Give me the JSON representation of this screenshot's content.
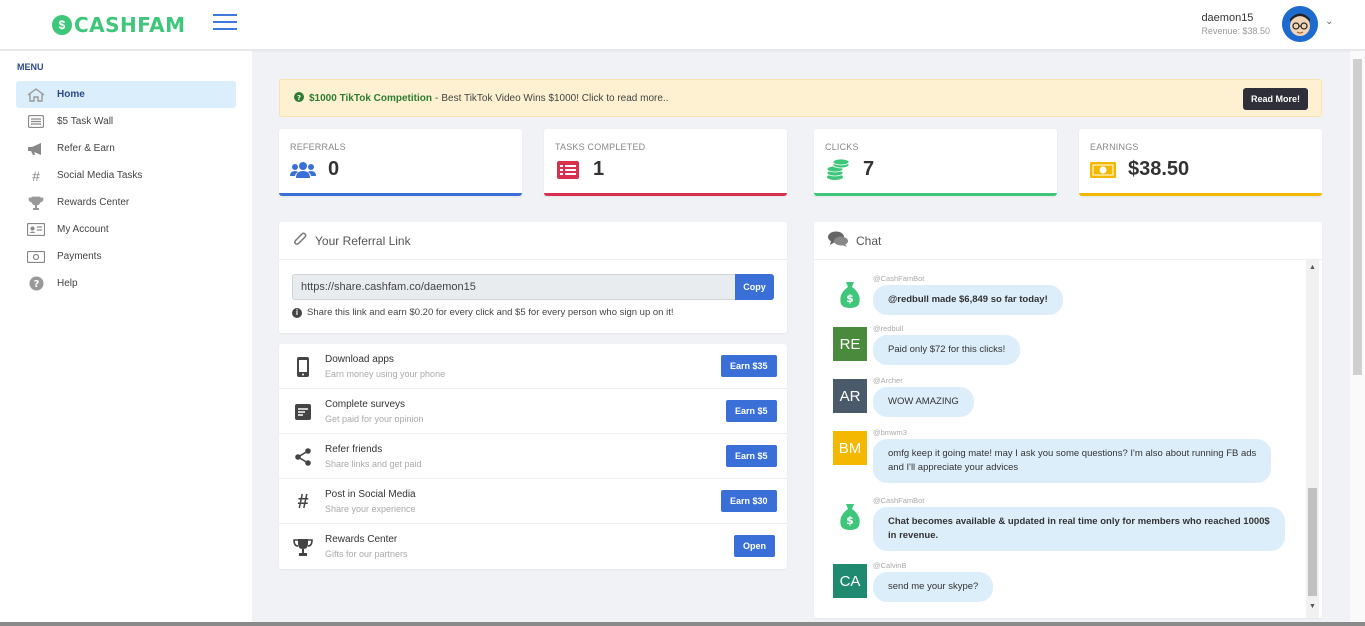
{
  "header": {
    "logo_badge": "$",
    "logo_text": "CASHFAM",
    "username": "daemon15",
    "revenue": "Revenue: $38.50"
  },
  "sidebar": {
    "menu_label": "MENU",
    "items": [
      {
        "label": "Home",
        "icon": "home-icon"
      },
      {
        "label": "$5 Task Wall",
        "icon": "list-icon"
      },
      {
        "label": "Refer & Earn",
        "icon": "megaphone-icon"
      },
      {
        "label": "Social Media Tasks",
        "icon": "hashtag-icon"
      },
      {
        "label": "Rewards Center",
        "icon": "trophy-icon"
      },
      {
        "label": "My Account",
        "icon": "id-card-icon"
      },
      {
        "label": "Payments",
        "icon": "money-icon"
      },
      {
        "label": "Help",
        "icon": "help-icon"
      }
    ]
  },
  "banner": {
    "title": "$1000 TikTok Competition",
    "separator": "-",
    "text": "Best TikTok Video Wins $1000! Click to read more..",
    "button": "Read More!"
  },
  "stats": [
    {
      "label": "REFERRALS",
      "value": "0",
      "color": "#3a6fd8"
    },
    {
      "label": "TASKS COMPLETED",
      "value": "1",
      "color": "#d9304f"
    },
    {
      "label": "CLICKS",
      "value": "7",
      "color": "#3ec77a"
    },
    {
      "label": "EARNINGS",
      "value": "$38.50",
      "color": "#f5b800"
    }
  ],
  "referral": {
    "title": "Your Referral Link",
    "link": "https://share.cashfam.co/daemon15",
    "copy": "Copy",
    "note": "Share this link and earn $0.20 for every click and $5 for every person who sign up on it!"
  },
  "tasks": [
    {
      "title": "Download apps",
      "sub": "Earn money using your phone",
      "button": "Earn $35"
    },
    {
      "title": "Complete surveys",
      "sub": "Get paid for your opinion",
      "button": "Earn $5"
    },
    {
      "title": "Refer friends",
      "sub": "Share links and get paid",
      "button": "Earn $5"
    },
    {
      "title": "Post in Social Media",
      "sub": "Share your experience",
      "button": "Earn $30"
    },
    {
      "title": "Rewards Center",
      "sub": "Gifts for our partners",
      "button": "Open"
    }
  ],
  "chat": {
    "title": "Chat",
    "messages": [
      {
        "user": "@CashFamBot",
        "avatar": "$",
        "avatar_color": "#3ec77a",
        "text": "@redbull made $6,849 so far today!",
        "bold": true
      },
      {
        "user": "@redbull",
        "avatar": "RE",
        "avatar_color": "#4a8a3c",
        "text": "Paid only $72 for this clicks!",
        "bold": false
      },
      {
        "user": "@Archer",
        "avatar": "AR",
        "avatar_color": "#4a5a6a",
        "text": "WOW AMAZING",
        "bold": false
      },
      {
        "user": "@bmwm3",
        "avatar": "BM",
        "avatar_color": "#f5b800",
        "text": "omfg keep it going mate! may I ask you some questions? I'm also about running FB ads",
        "text2": "and I'll appreciate your advices",
        "bold": false
      },
      {
        "user": "@CashFamBot",
        "avatar": "$",
        "avatar_color": "#3ec77a",
        "text": "Chat becomes available & updated in real time only for members who reached 1000$",
        "text2": "in revenue.",
        "bold": true
      },
      {
        "user": "@CalvinB",
        "avatar": "CA",
        "avatar_color": "#1f8a70",
        "text": "send me your skype?",
        "bold": false
      }
    ]
  }
}
